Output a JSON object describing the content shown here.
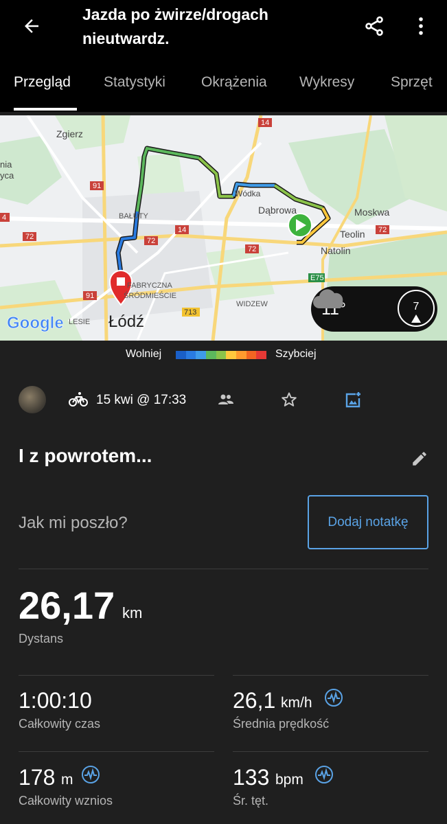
{
  "header": {
    "title": "Jazda po żwirze/drogach nieutwardz.",
    "back_icon": "arrow-left-icon",
    "share_icon": "share-icon",
    "more_icon": "more-vertical-icon"
  },
  "tabs": [
    {
      "label": "Przegląd",
      "active": true
    },
    {
      "label": "Statystyki",
      "active": false
    },
    {
      "label": "Okrążenia",
      "active": false
    },
    {
      "label": "Wykresy",
      "active": false
    },
    {
      "label": "Sprzęt",
      "active": false
    }
  ],
  "map": {
    "places": {
      "zgierz": "Zgierz",
      "dabrowa": "Dąbrowa",
      "moskwa": "Moskwa",
      "teolin": "Teolin",
      "natolin": "Natolin",
      "widzew": "WIDZEW",
      "lodz": "Łódź",
      "baluty": "BAŁUTY",
      "wodka": "Wódka",
      "fabryczna": "FABRYCZNA",
      "srodmiescie": "ŚRÓDMIEŚCIE",
      "lesie": "LESIE",
      "edge1": "nia",
      "edge2": "yca"
    },
    "road_shields": {
      "r14a": "14",
      "r14b": "14",
      "r72a": "72",
      "r72b": "72",
      "r72c": "72",
      "r72d": "72",
      "r91a": "91",
      "r91b": "91",
      "r713": "713",
      "e75": "E75",
      "r4": "4"
    },
    "google_logo": "Google",
    "weather": {
      "temperature": "11°",
      "wind": "7",
      "cloud_icon": "cloud-icon"
    }
  },
  "legend": {
    "slow_label": "Wolniej",
    "fast_label": "Szybciej",
    "colors": [
      "#1a5fc7",
      "#2a7be0",
      "#3f9be8",
      "#5cb85c",
      "#8bc34a",
      "#ffc83d",
      "#ff9a2e",
      "#f26522",
      "#e53935"
    ]
  },
  "activity": {
    "date": "15 kwi @ 17:33",
    "title": "I z powrotem...",
    "note_prompt": "Jak mi poszło?",
    "note_button": "Dodaj notatkę",
    "distance": {
      "value": "26,17",
      "unit": "km",
      "label": "Dystans"
    },
    "stats": {
      "time": {
        "value": "1:00:10",
        "unit": "",
        "label": "Całkowity czas"
      },
      "speed": {
        "value": "26,1",
        "unit": "km/h",
        "label": "Średnia prędkość"
      },
      "ascent": {
        "value": "178",
        "unit": "m",
        "label": "Całkowity wznios"
      },
      "hr": {
        "value": "133",
        "unit": "bpm",
        "label": "Śr. tęt."
      }
    }
  },
  "colors": {
    "accent": "#5aa3e6",
    "background": "#1f1f1f",
    "header_bg": "#000000"
  }
}
